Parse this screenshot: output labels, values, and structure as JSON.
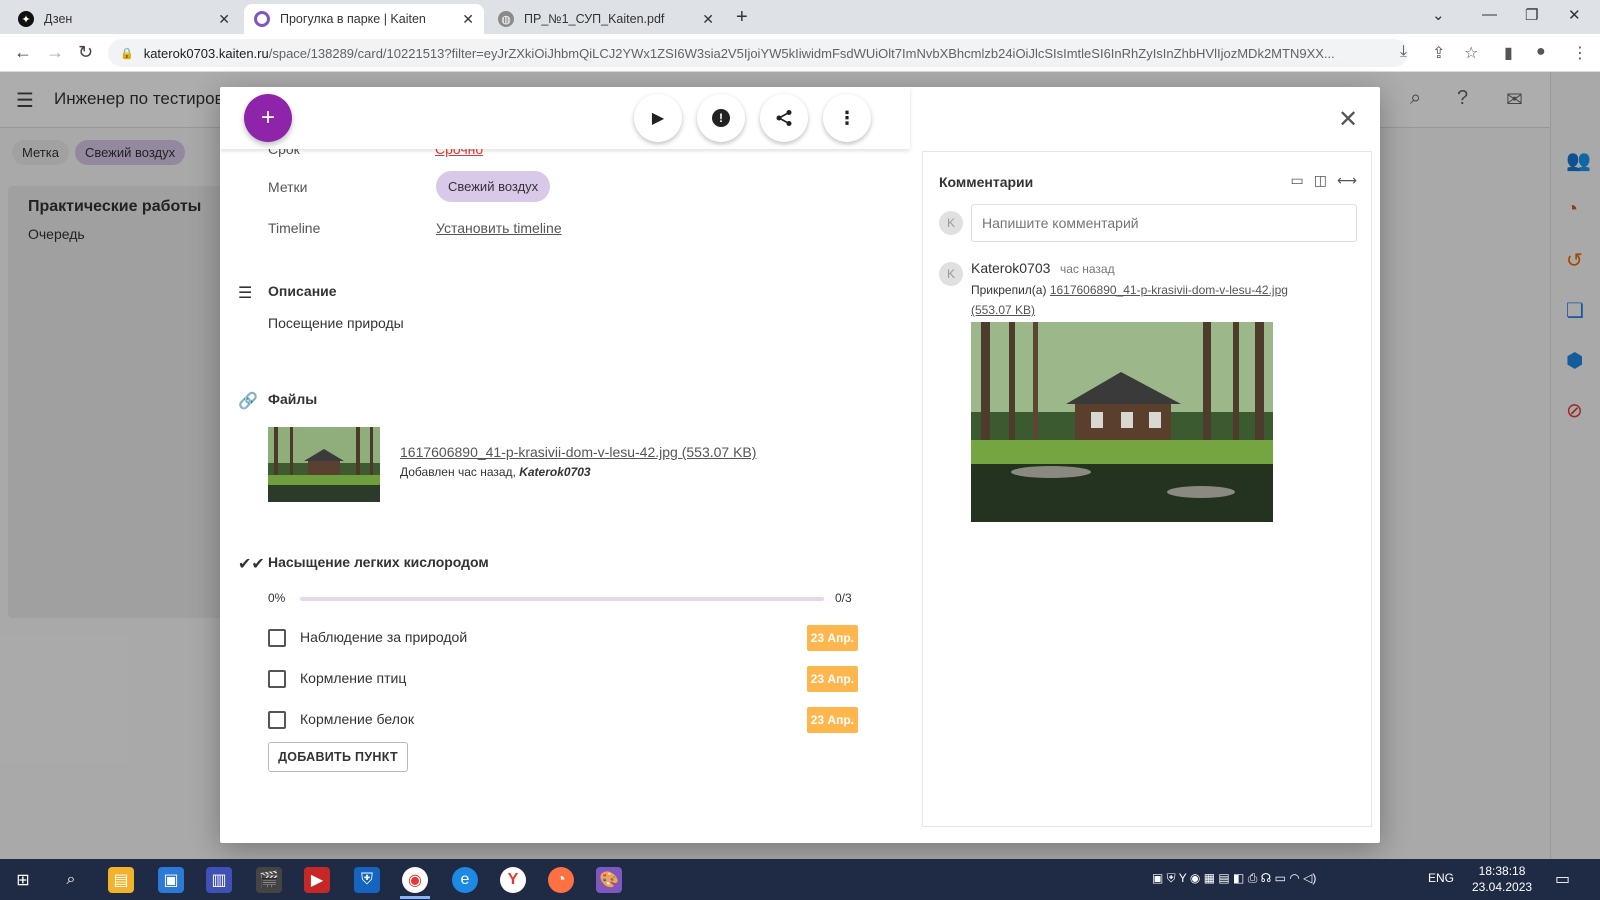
{
  "browser": {
    "tabs": [
      {
        "title": "Дзен",
        "favicon": "dzen-icon"
      },
      {
        "title": "Прогулка в парке | Kaiten",
        "favicon": "kaiten-icon"
      },
      {
        "title": "ПР_№1_СУП_Kaiten.pdf",
        "favicon": "globe-icon"
      }
    ],
    "url_host": "katerok0703.kaiten.ru",
    "url_path": "/space/138289/card/10221513?filter=eyJrZXkiOiJhbmQiLCJ2YWx1ZSI6W3sia2V5IjoiYW5kIiwidmFsdWUiOlt7ImNvbXBhcmlzb24iOiJlcSIsImtleSI6InRhZyIsInZhbHVlIjozMDk2MTN9XX..."
  },
  "app": {
    "space_title": "Инженер по тестиров",
    "filter": {
      "label": "Метка",
      "tag": "Свежий воздух"
    },
    "lane": {
      "title": "Практические работы",
      "column": "Очередь"
    },
    "avatar_letter": "K"
  },
  "card": {
    "props": {
      "deadline_label": "Срок",
      "deadline_value": "Срочно",
      "tags_label": "Метки",
      "tag_value": "Свежий воздух",
      "timeline_label": "Timeline",
      "timeline_link": "Установить timeline"
    },
    "description": {
      "title": "Описание",
      "text": "Посещение природы"
    },
    "files": {
      "title": "Файлы",
      "name": "1617606890_41-p-krasivii-dom-v-lesu-42.jpg (553.07 KB)",
      "added_prefix": "Добавлен час назад, ",
      "added_by": "Katerok0703"
    },
    "checklist": {
      "title": "Насыщение легких кислородом",
      "percent_text": "0%",
      "progress": 0,
      "count_text": "0/3",
      "items": [
        {
          "text": "Наблюдение за природой",
          "date": "23 Апр."
        },
        {
          "text": "Кормление птиц",
          "date": "23 Апр."
        },
        {
          "text": "Кормление белок",
          "date": "23 Апр."
        }
      ],
      "add_label": "ДОБАВИТЬ ПУНКТ"
    }
  },
  "comments": {
    "title": "Комментарии",
    "placeholder": "Напишите комментарий",
    "avatar_letter": "K",
    "item": {
      "author": "Katerok0703",
      "time": "час назад",
      "text_prefix": "Прикрепил(а) ",
      "file_link": "1617606890_41-p-krasivii-dom-v-lesu-42.jpg",
      "file_size": "(553.07 KB)"
    }
  },
  "taskbar": {
    "lang": "ENG",
    "time": "18:38:18",
    "date": "23.04.2023"
  },
  "colors": {
    "accent": "#8e24aa",
    "tag_bg": "#d9c9e8",
    "date_badge": "#ffb74d",
    "deadline_red": "#e53935"
  }
}
